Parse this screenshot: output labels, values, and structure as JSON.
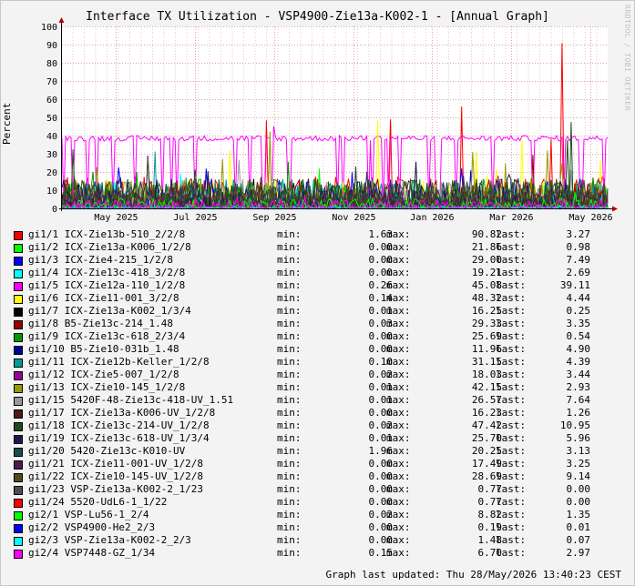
{
  "title": "Interface TX Utilization - VSP4900-Zie13a-K002-1 - [Annual Graph]",
  "vendor_text": "RRDTOOL / TOBI OETIKER",
  "footer": "Graph last updated: Thu 28/May/2026 13:40:23 CEST",
  "chart_data": {
    "type": "line",
    "title": "Interface TX Utilization - VSP4900-Zie13a-K002-1 - [Annual Graph]",
    "ylabel": "Percent",
    "xlabel": "",
    "ylim": [
      0,
      100
    ],
    "yticks": [
      0,
      10,
      20,
      30,
      40,
      50,
      60,
      70,
      80,
      90,
      100
    ],
    "xticks": [
      "May 2025",
      "Jul 2025",
      "Sep 2025",
      "Nov 2025",
      "Jan 2026",
      "Mar 2026",
      "May 2026"
    ],
    "grid": true,
    "legend_placement": "bottom",
    "labels": {
      "min": "min:",
      "max": "max:",
      "last": "last:"
    },
    "series": [
      {
        "name": "gi1/1 ICX-Zie13b-510_2/2/8",
        "color": "#ff0000",
        "min": "1.63",
        "max": "90.82",
        "last": "3.27"
      },
      {
        "name": "gi1/2 ICX-Zie13a-K006_1/2/8",
        "color": "#00ff00",
        "min": "0.00",
        "max": "21.86",
        "last": "0.98"
      },
      {
        "name": "gi1/3 ICX-Zie4-215_1/2/8",
        "color": "#0000ff",
        "min": "0.00",
        "max": "29.00",
        "last": "7.49"
      },
      {
        "name": "gi1/4 ICX-Zie13c-418_3/2/8",
        "color": "#00ffff",
        "min": "0.00",
        "max": "19.21",
        "last": "2.69"
      },
      {
        "name": "gi1/5 ICX-Zie12a-110_1/2/8",
        "color": "#ff00ff",
        "min": "0.26",
        "max": "45.08",
        "last": "39.11"
      },
      {
        "name": "gi1/6 ICX-Zie11-001_3/2/8",
        "color": "#ffff00",
        "min": "0.14",
        "max": "48.32",
        "last": "4.44"
      },
      {
        "name": "gi1/7 ICX-Zie13a-K002_1/3/4",
        "color": "#000000",
        "min": "0.01",
        "max": "16.25",
        "last": "0.25"
      },
      {
        "name": "gi1/8 B5-Zie13c-214_1.48",
        "color": "#990000",
        "min": "0.03",
        "max": "29.33",
        "last": "3.35"
      },
      {
        "name": "gi1/9 ICX-Zie13c-618_2/3/4",
        "color": "#009900",
        "min": "0.00",
        "max": "25.69",
        "last": "0.54"
      },
      {
        "name": "gi1/10 B5-Zie10-031b_1.48",
        "color": "#000099",
        "min": "0.00",
        "max": "11.96",
        "last": "4.90"
      },
      {
        "name": "gi1/11 ICX-Zie12b-Keller_1/2/8",
        "color": "#009999",
        "min": "0.10",
        "max": "31.15",
        "last": "4.39"
      },
      {
        "name": "gi1/12 ICX-Zie5-007_1/2/8",
        "color": "#990099",
        "min": "0.02",
        "max": "18.03",
        "last": "3.44"
      },
      {
        "name": "gi1/13 ICX-Zie10-145_1/2/8",
        "color": "#999900",
        "min": "0.01",
        "max": "42.15",
        "last": "2.93"
      },
      {
        "name": "gi1/15 5420F-48-Zie13c-418-UV_1.51",
        "color": "#999999",
        "min": "0.01",
        "max": "26.57",
        "last": "7.64"
      },
      {
        "name": "gi1/17 ICX-Zie13a-K006-UV_1/2/8",
        "color": "#4d1a1a",
        "min": "0.00",
        "max": "16.23",
        "last": "1.26"
      },
      {
        "name": "gi1/18 ICX-Zie13c-214-UV_1/2/8",
        "color": "#1a4d1a",
        "min": "0.02",
        "max": "47.42",
        "last": "10.95"
      },
      {
        "name": "gi1/19 ICX-Zie13c-618-UV_1/3/4",
        "color": "#1a1a4d",
        "min": "0.01",
        "max": "25.70",
        "last": "5.96"
      },
      {
        "name": "gi1/20 5420-Zie13c-K010-UV",
        "color": "#1a4d4d",
        "min": "1.96",
        "max": "20.25",
        "last": "3.13"
      },
      {
        "name": "gi1/21 ICX-Zie11-001-UV_1/2/8",
        "color": "#4d1a4d",
        "min": "0.00",
        "max": "17.49",
        "last": "3.25"
      },
      {
        "name": "gi1/22 ICX-Zie10-145-UV_1/2/8",
        "color": "#4d4d1a",
        "min": "0.00",
        "max": "28.69",
        "last": "9.14"
      },
      {
        "name": "gi1/23 VSP-Zie13a-K002-2_1/23",
        "color": "#4d4d4d",
        "min": "0.00",
        "max": "0.77",
        "last": "0.00"
      },
      {
        "name": "gi1/24 5520-UdL6-1_1/22",
        "color": "#ff0000",
        "min": "0.00",
        "max": "0.77",
        "last": "0.00"
      },
      {
        "name": "gi2/1 VSP-Lu56-1_2/4",
        "color": "#00ff00",
        "min": "0.02",
        "max": "8.82",
        "last": "1.35"
      },
      {
        "name": "gi2/2 VSP4900-He2_2/3",
        "color": "#0000ff",
        "min": "0.00",
        "max": "0.19",
        "last": "0.01"
      },
      {
        "name": "gi2/3 VSP-Zie13a-K002-2_2/3",
        "color": "#00ffff",
        "min": "0.00",
        "max": "1.48",
        "last": "0.07"
      },
      {
        "name": "gi2/4 VSP7448-GZ_1/34",
        "color": "#ff00ff",
        "min": "0.15",
        "max": "6.70",
        "last": "2.97"
      }
    ]
  }
}
